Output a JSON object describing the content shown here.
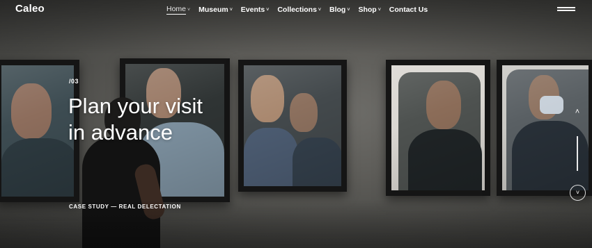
{
  "brand": {
    "logo": "Caleo"
  },
  "nav": {
    "items": [
      {
        "label": "Home",
        "has_dropdown": true,
        "active": true
      },
      {
        "label": "Museum",
        "has_dropdown": true
      },
      {
        "label": "Events",
        "has_dropdown": true
      },
      {
        "label": "Collections",
        "has_dropdown": true
      },
      {
        "label": "Blog",
        "has_dropdown": true
      },
      {
        "label": "Shop",
        "has_dropdown": true
      },
      {
        "label": "Contact Us",
        "has_dropdown": false
      }
    ],
    "dropdown_glyph": "˅",
    "menu_icon": "hamburger-icon"
  },
  "hero": {
    "slide_number": "/03",
    "headline_line1": "Plan your visit",
    "headline_line2": "in advance",
    "caption": "CASE STUDY — REAL DELECTATION"
  },
  "slider": {
    "up_icon": "chevron-up-icon",
    "up_glyph": "˄",
    "down_icon": "chevron-down-icon",
    "down_glyph": "˅"
  },
  "colors": {
    "text": "#ffffff",
    "wall": "#5d5c58",
    "frame": "#151515"
  }
}
